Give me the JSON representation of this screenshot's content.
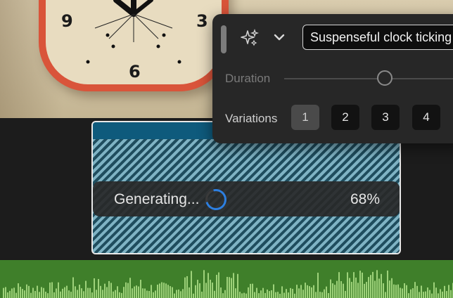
{
  "panel": {
    "prompt_value": "Suspenseful clock ticking",
    "duration_label": "Duration",
    "duration_level": 0.55,
    "variations_label": "Variations",
    "variations": [
      "1",
      "2",
      "3",
      "4"
    ],
    "selected_variation": "1",
    "icons": {
      "generate": "sparkle-icon",
      "menu": "chevron-down-icon",
      "handle": "drag-handle"
    }
  },
  "clip": {
    "status_label": "Generating...",
    "progress_text": "68%",
    "progress": 0.68
  },
  "preview": {
    "clock_numbers": [
      "9",
      "3",
      "6"
    ]
  },
  "colors": {
    "accent": "#2d7fe0",
    "clip_header": "#0e5a7c",
    "audio_track": "#3f7f2a",
    "clock_frame": "#d9543a"
  }
}
